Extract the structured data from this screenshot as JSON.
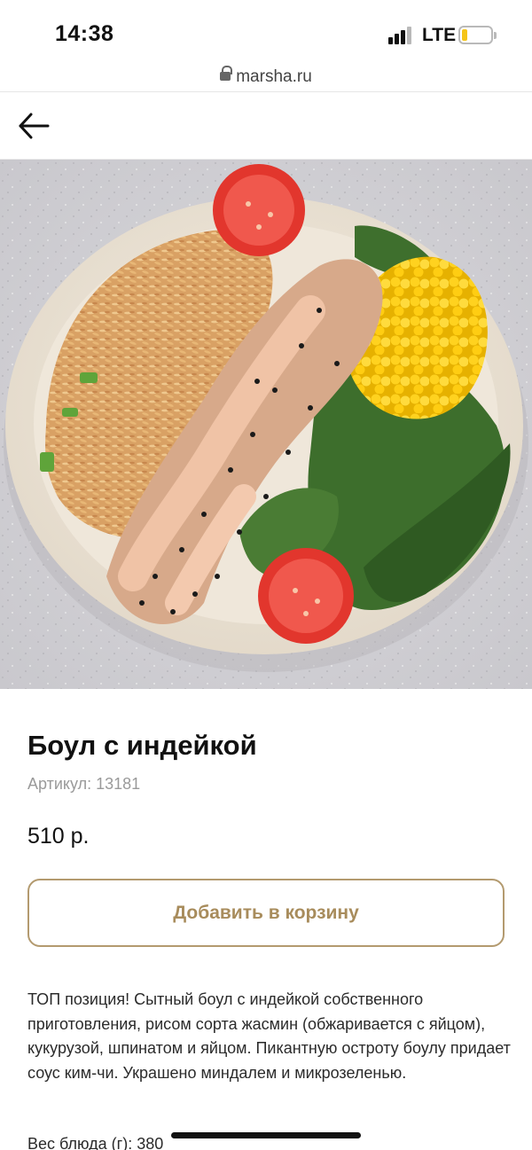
{
  "status_bar": {
    "time": "14:38",
    "network": "LTE"
  },
  "browser": {
    "url": "marsha.ru"
  },
  "product": {
    "title": "Боул с индейкой",
    "sku": "Артикул: 13181",
    "price": "510 р.",
    "add_to_cart_label": "Добавить в корзину",
    "description": "ТОП позиция! Сытный боул с индейкой собственного приготовления, рисом сорта жасмин (обжаривается с яйцом), кукурузой, шпинатом и яйцом. Пикантную остроту боулу придает соус ким-чи. Украшено миндалем и микрозеленью.",
    "weight": "Вес блюда (г): 380"
  },
  "colors": {
    "accent": "#b39a6f",
    "accent_text": "#a88c5c",
    "battery": "#f5c518"
  },
  "icons": {
    "back": "arrow-left-icon",
    "lock": "lock-icon"
  }
}
